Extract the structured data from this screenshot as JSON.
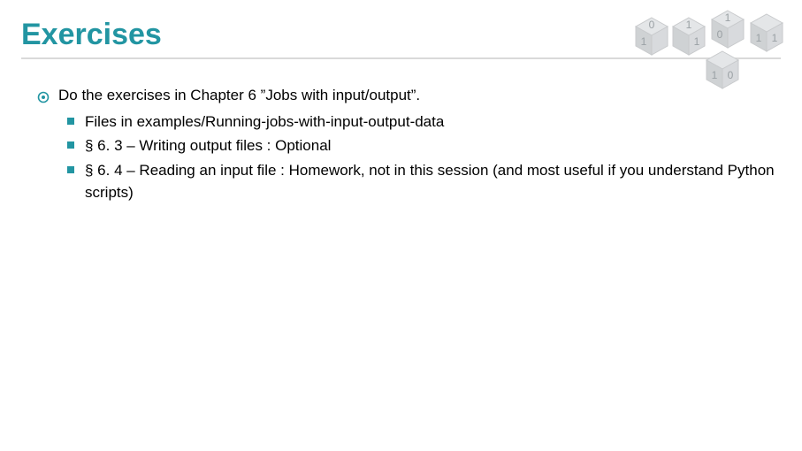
{
  "title": "Exercises",
  "main": {
    "text": "Do the exercises in Chapter 6 ”Jobs with input/output”.",
    "sub": [
      "Files in examples/Running-jobs-with-input-output-data",
      "§ 6. 3 – Writing output files : Optional",
      "§ 6. 4 – Reading an input file : Homework, not in this session (and most useful if you understand Python scripts)"
    ]
  }
}
